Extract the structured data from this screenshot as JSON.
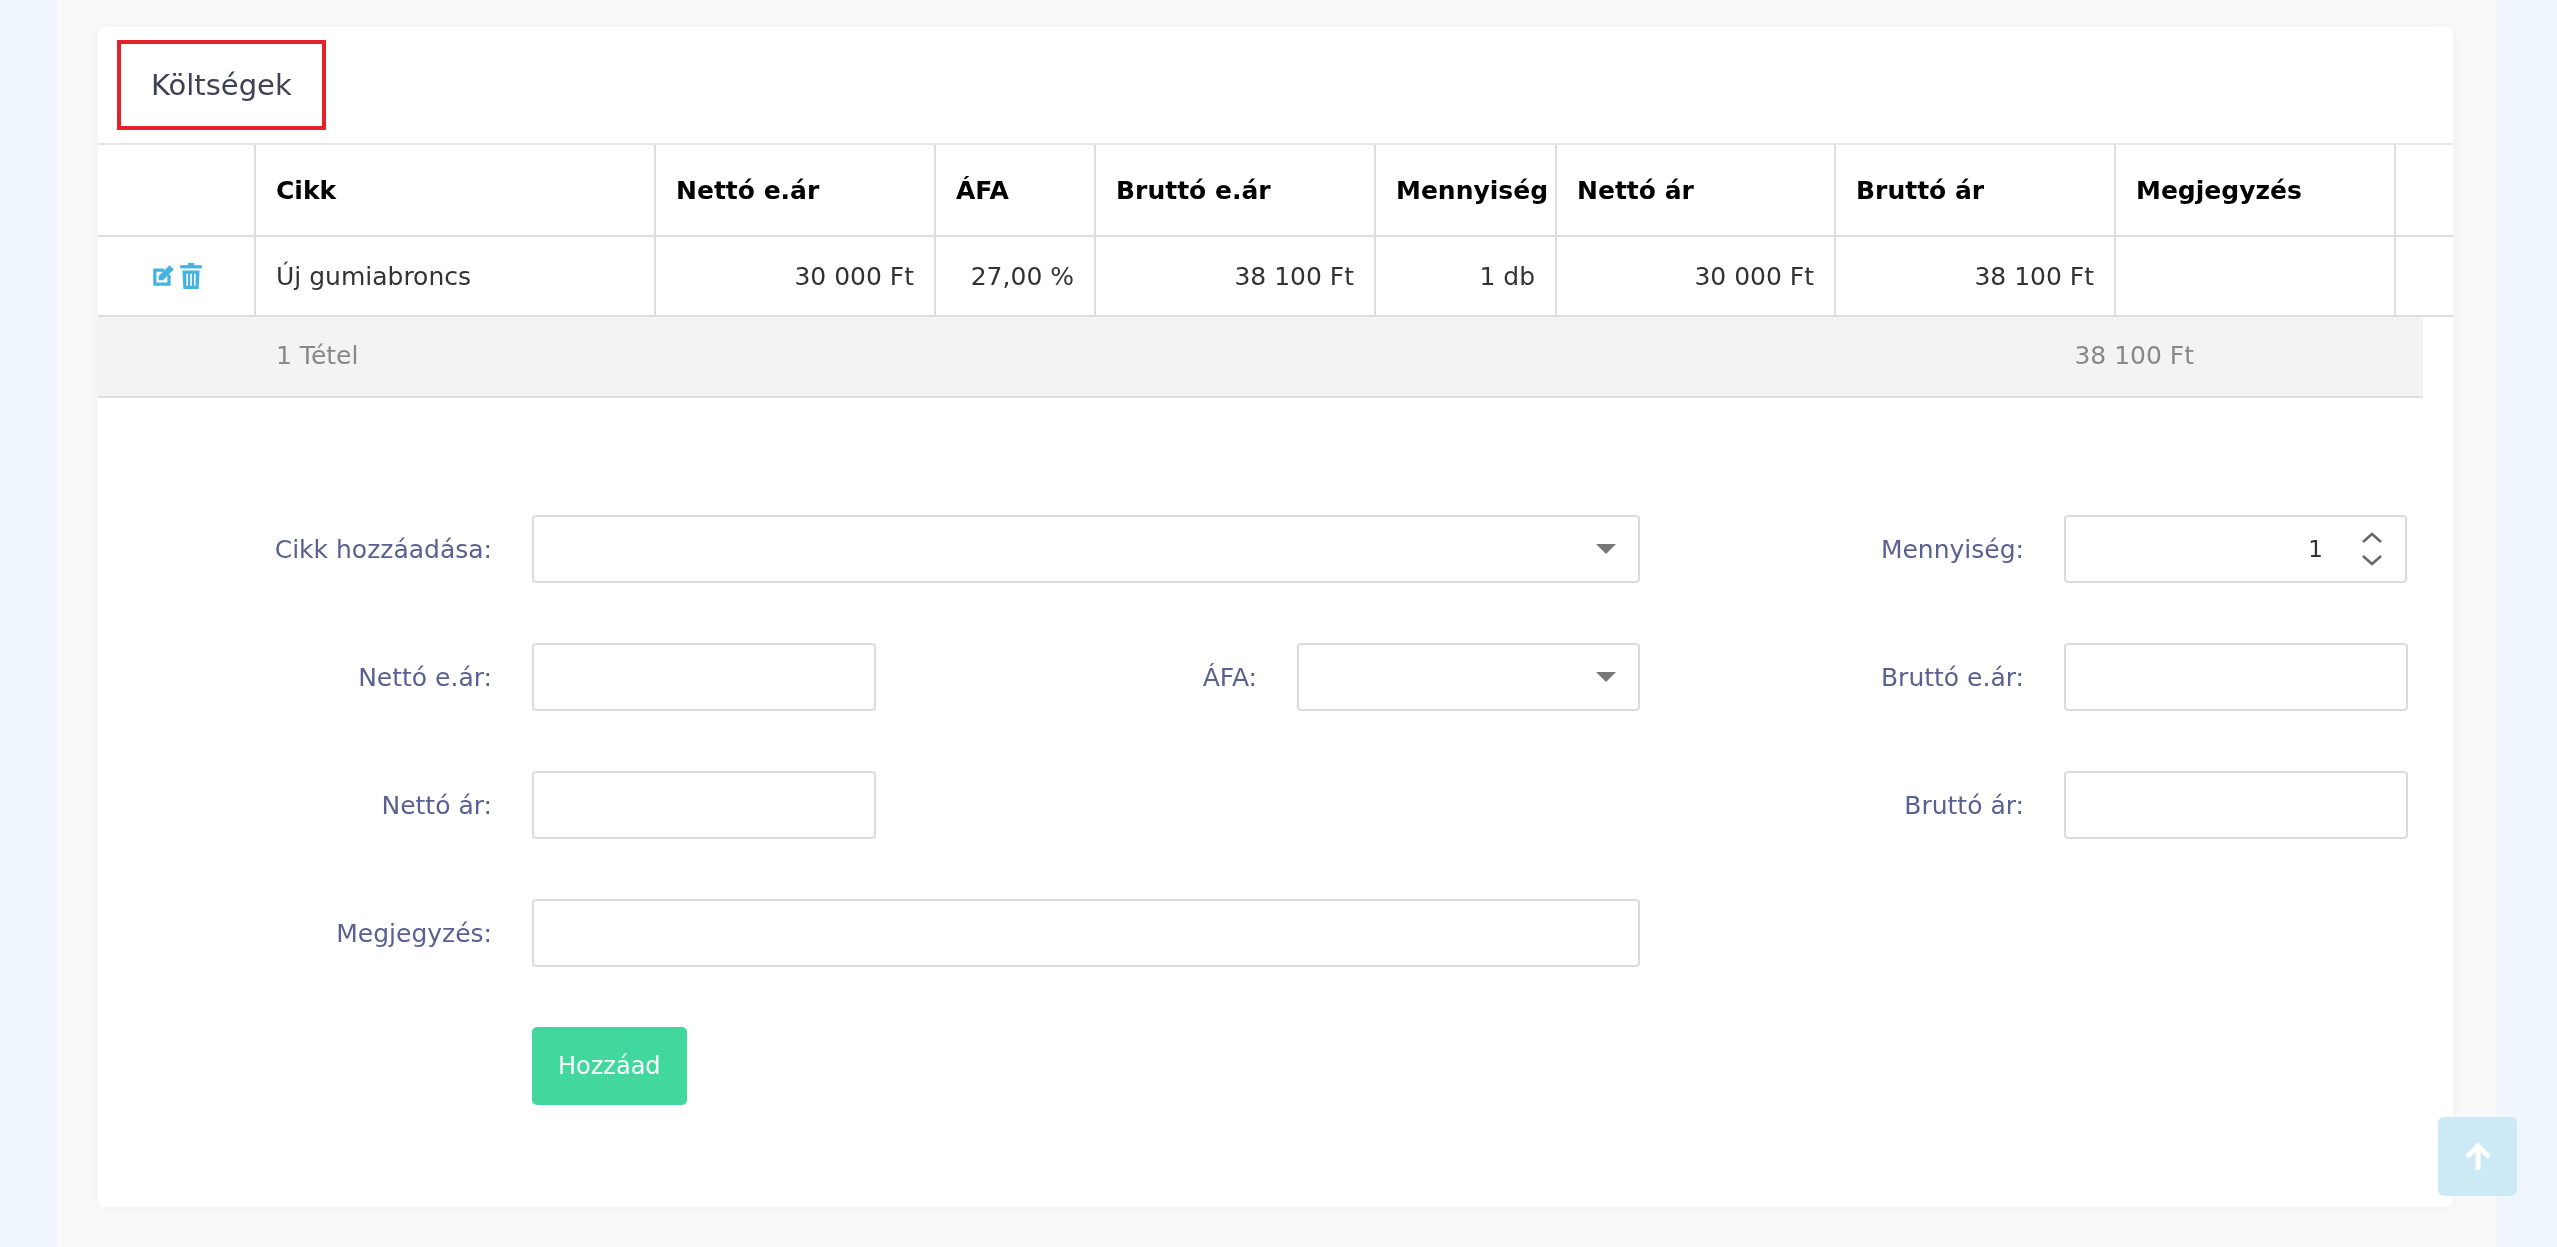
{
  "card": {
    "title": "Költségek",
    "title_highlighted": true
  },
  "table": {
    "columns": [
      "Cikk",
      "Nettó e.ár",
      "ÁFA",
      "Bruttó e.ár",
      "Mennyiség",
      "Nettó ár",
      "Bruttó ár",
      "Megjegyzés"
    ],
    "rows": [
      {
        "cells": [
          "Új gumiabroncs",
          "30 000 Ft",
          "27,00 %",
          "38 100 Ft",
          "1 db",
          "30 000 Ft",
          "38 100 Ft"
        ]
      }
    ],
    "footer": {
      "count": "1 Tétel",
      "total": "38 100 Ft"
    }
  },
  "form": {
    "rows": [
      {
        "left": {
          "label": "Cikk hozzáadása:",
          "kind": "select",
          "wide": true
        },
        "right": {
          "label": "Mennyiség:",
          "kind": "number",
          "value": "1"
        }
      },
      {
        "left": {
          "label": "Nettó e.ár:",
          "kind": "text",
          "wide": false
        },
        "middle": {
          "label": "ÁFA:",
          "kind": "select",
          "wide": false
        },
        "right": {
          "label": "Bruttó e.ár:",
          "kind": "text"
        }
      },
      {
        "left": {
          "label": "Nettó ár:",
          "kind": "text",
          "wide": false
        },
        "right": {
          "label": "Bruttó ár:",
          "kind": "text"
        }
      },
      {
        "left": {
          "label": "Megjegyzés:",
          "kind": "text",
          "wide": true
        }
      }
    ],
    "submit": "Hozzáad"
  }
}
